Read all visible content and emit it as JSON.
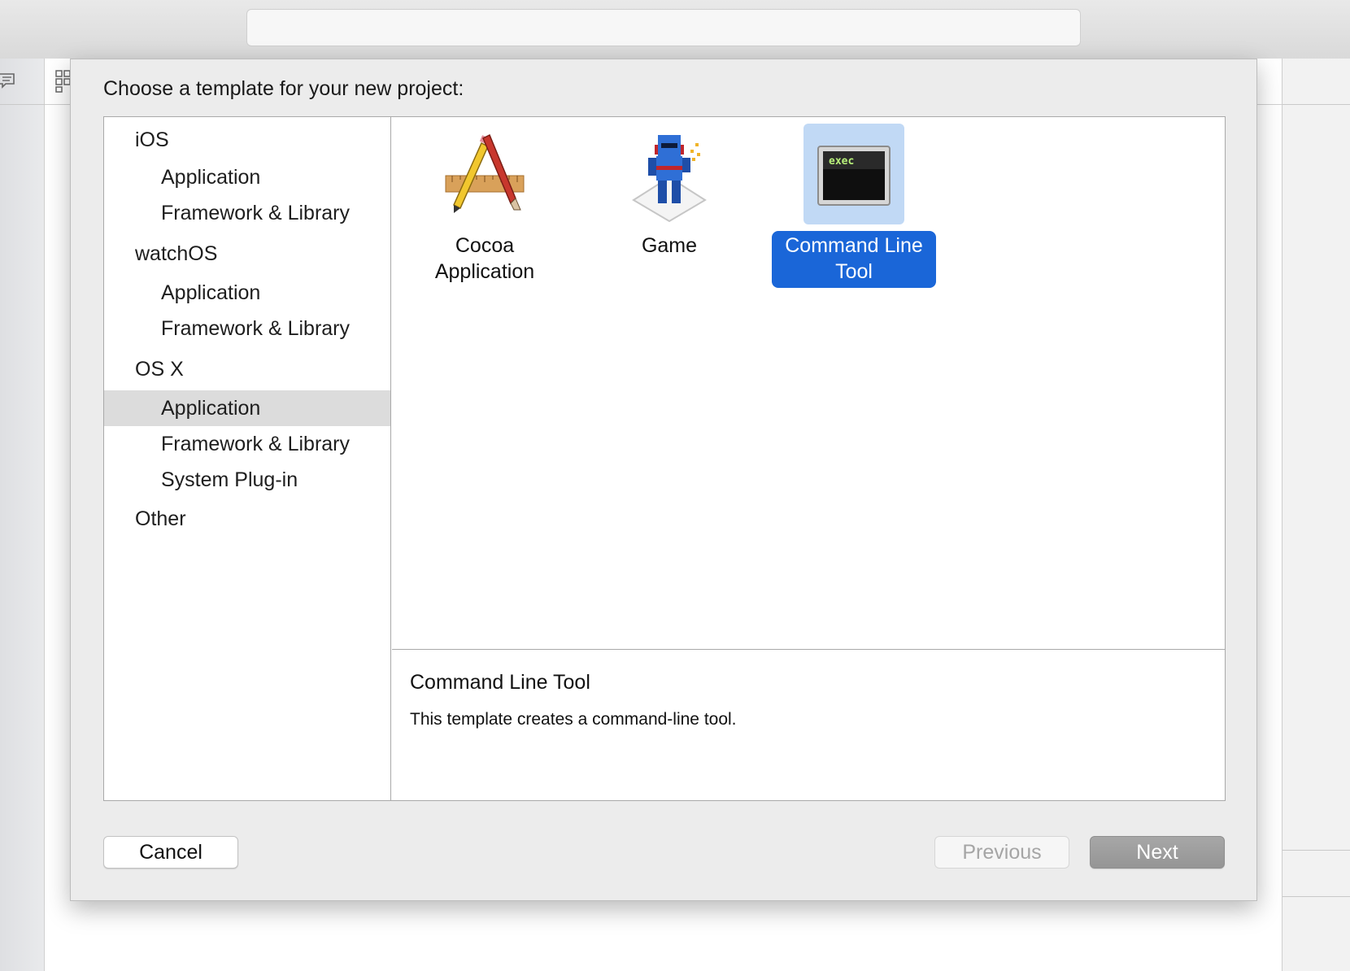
{
  "dialog": {
    "title": "Choose a template for your new project:"
  },
  "sidebar": {
    "groups": [
      {
        "label": "iOS",
        "items": [
          "Application",
          "Framework & Library"
        ]
      },
      {
        "label": "watchOS",
        "items": [
          "Application",
          "Framework & Library"
        ]
      },
      {
        "label": "OS X",
        "items": [
          "Application",
          "Framework & Library",
          "System Plug-in"
        ],
        "selected_item": "Application"
      },
      {
        "label": "Other",
        "items": []
      }
    ]
  },
  "templates": [
    {
      "label_line1": "Cocoa",
      "label_line2": "Application",
      "icon": "cocoa-app-icon"
    },
    {
      "label_line1": "Game",
      "label_line2": "",
      "icon": "game-icon"
    },
    {
      "label_line1": "Command Line",
      "label_line2": "Tool",
      "icon": "terminal-icon",
      "selected": true,
      "icon_text": "exec"
    }
  ],
  "description": {
    "title": "Command Line Tool",
    "text": "This template creates a command-line tool."
  },
  "buttons": {
    "cancel": "Cancel",
    "previous": "Previous",
    "next": "Next"
  },
  "colors": {
    "selection_blue": "#1a66d8",
    "icon_highlight": "#c1d9f5",
    "sidebar_selected": "#dcdcdc"
  }
}
